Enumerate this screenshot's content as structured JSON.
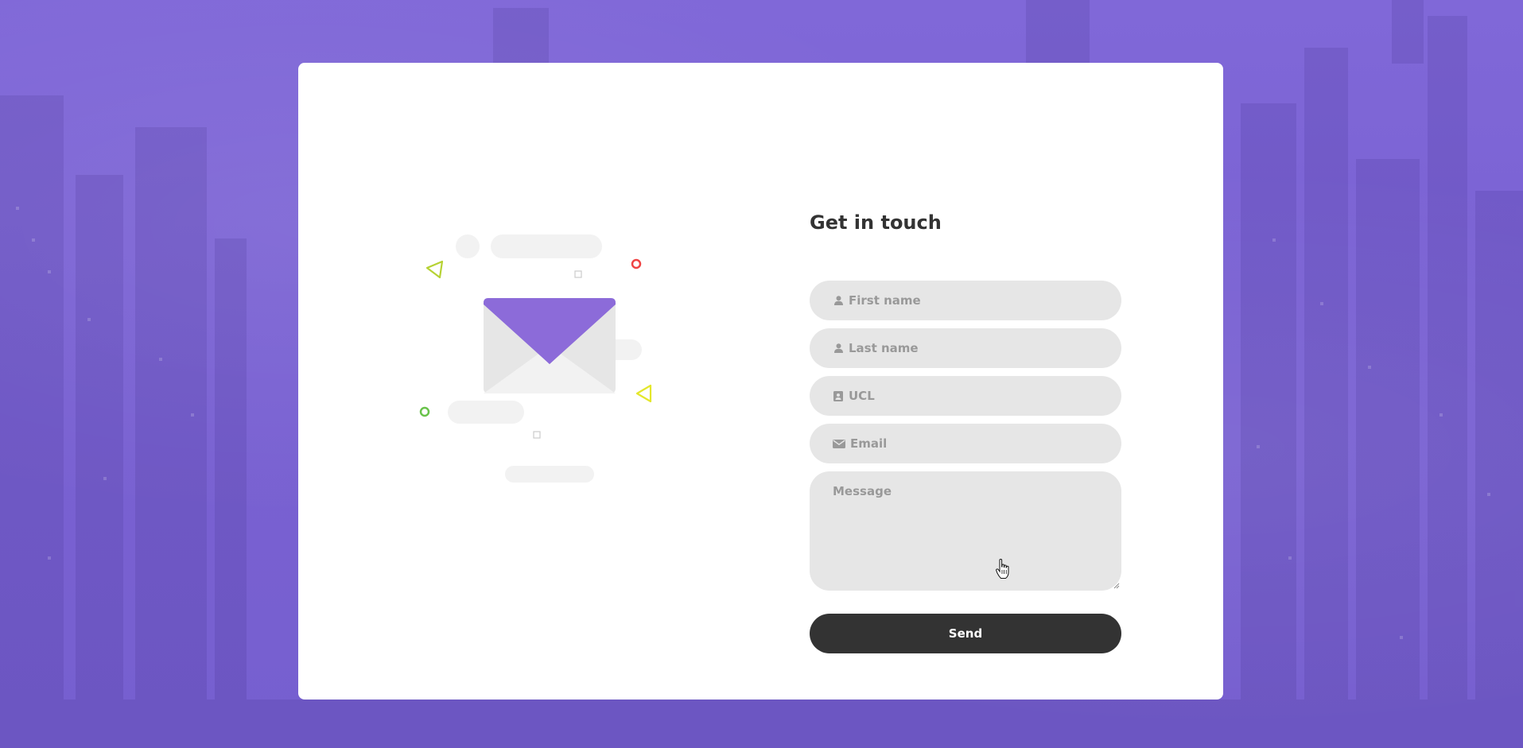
{
  "form": {
    "title": "Get in touch",
    "fields": [
      {
        "name": "first-name",
        "placeholder": "First name",
        "value": "",
        "icon": "user-icon"
      },
      {
        "name": "last-name",
        "placeholder": "Last name",
        "value": "",
        "icon": "user-icon"
      },
      {
        "name": "ucl",
        "placeholder": "UCL",
        "value": "",
        "icon": "contact-card-icon"
      },
      {
        "name": "email",
        "placeholder": "Email",
        "value": "",
        "icon": "envelope-icon"
      }
    ],
    "message": {
      "placeholder": "Message",
      "value": ""
    },
    "send_label": "Send"
  },
  "colors": {
    "background": "#7c66d6",
    "accent_purple": "#8c6bd9",
    "button_dark": "#333333",
    "field_gray": "#e6e6e6",
    "placeholder_gray": "#999999",
    "decor_red": "#ef4444",
    "decor_green": "#69c34b",
    "decor_yellow": "#e4e72b"
  }
}
